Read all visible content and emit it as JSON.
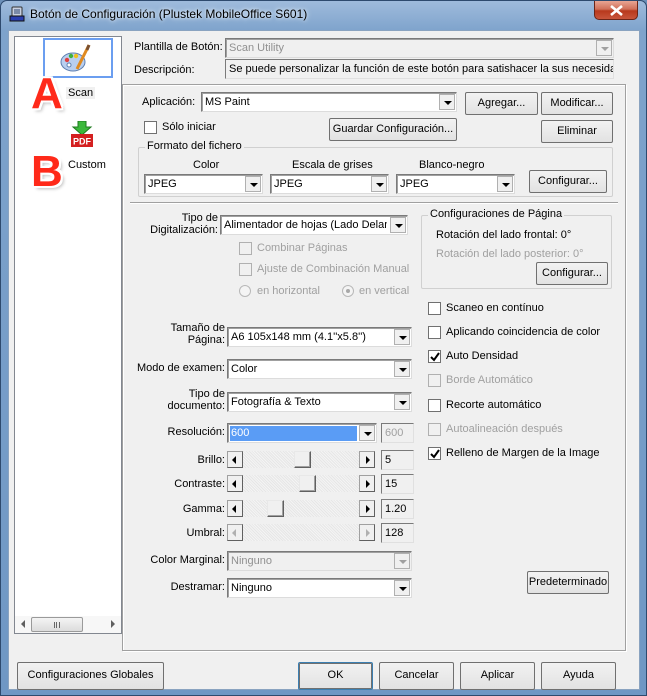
{
  "window": {
    "title": "Botón de Configuración (Plustek MobileOffice S601)",
    "close_icon": "close-x-icon"
  },
  "button_list": {
    "items": [
      {
        "label": "Scan",
        "icon": "paint-palette-icon",
        "selected": true,
        "marker": "A"
      },
      {
        "label": "Custom",
        "icon": "pdf-download-icon",
        "selected": false,
        "marker": "B"
      }
    ]
  },
  "header": {
    "template_label": "Plantilla de Botón:",
    "template_value": "Scan Utility",
    "description_label": "Descripción:",
    "description_value": "Se puede personalizar la función de este botón para satishacer la sus necesidade"
  },
  "application": {
    "label": "Aplicación:",
    "value": "MS Paint",
    "add_button": "Agregar...",
    "modify_button": "Modificar...",
    "delete_button": "Eliminar",
    "save_config_button": "Guardar Configuración...",
    "only_launch_label": "Sólo iniciar",
    "only_launch_checked": false
  },
  "file_format": {
    "title": "Formato del fichero",
    "color_label": "Color",
    "color_value": "JPEG",
    "gray_label": "Escala de grises",
    "gray_value": "JPEG",
    "bw_label": "Blanco-negro",
    "bw_value": "JPEG",
    "configure_button": "Configurar..."
  },
  "scan_settings": {
    "scan_type_label_1": "Tipo de",
    "scan_type_label_2": "Digitalización:",
    "scan_type_value": "Alimentador de hojas (Lado Delante",
    "combine_pages_label": "Combinar Páginas",
    "manual_combine_label": "Ajuste de Combinación Manual",
    "horizontal_label": "en horizontal",
    "vertical_label": "en vertical",
    "orientation_selected": "vertical",
    "page_size_label_1": "Tamaño de",
    "page_size_label_2": "Página:",
    "page_size_value": "A6 105x148 mm (4.1''x5.8'')",
    "scan_mode_label": "Modo de examen:",
    "scan_mode_value": "Color",
    "doc_type_label_1": "Tipo de",
    "doc_type_label_2": "documento:",
    "doc_type_value": "Fotografía & Texto",
    "resolution_label": "Resolución:",
    "resolution_value": "600",
    "resolution_readout": "600",
    "brightness_label": "Brillo:",
    "brightness_value": "5",
    "brightness_fraction": 0.52,
    "contrast_label": "Contraste:",
    "contrast_value": "15",
    "contrast_fraction": 0.57,
    "gamma_label": "Gamma:",
    "gamma_value": "1.20",
    "gamma_fraction": 0.24,
    "threshold_label": "Umbral:",
    "threshold_value": "128",
    "margin_color_label": "Color Marginal:",
    "margin_color_value": "Ninguno",
    "descreen_label": "Destramar:",
    "descreen_value": "Ninguno",
    "default_button": "Predeterminado"
  },
  "page_config": {
    "title": "Configuraciones de Página",
    "front_rotation": "Rotación del lado frontal: 0°",
    "back_rotation": "Rotación del lado posterior: 0°",
    "configure_button": "Configurar..."
  },
  "options": [
    {
      "label": "Scaneo en contínuo",
      "checked": false,
      "disabled": false
    },
    {
      "label": "Aplicando coincidencia de color",
      "checked": false,
      "disabled": false
    },
    {
      "label": "Auto Densidad",
      "checked": true,
      "disabled": false
    },
    {
      "label": "Borde Automático",
      "checked": false,
      "disabled": true
    },
    {
      "label": "Recorte automático",
      "checked": false,
      "disabled": false
    },
    {
      "label": "Autoalineación después",
      "checked": false,
      "disabled": true
    },
    {
      "label": "Relleno de Margen de la Image",
      "checked": true,
      "disabled": false
    }
  ],
  "footer": {
    "global_settings_button": "Configuraciones Globales",
    "ok_button": "OK",
    "cancel_button": "Cancelar",
    "apply_button": "Aplicar",
    "help_button": "Ayuda"
  }
}
